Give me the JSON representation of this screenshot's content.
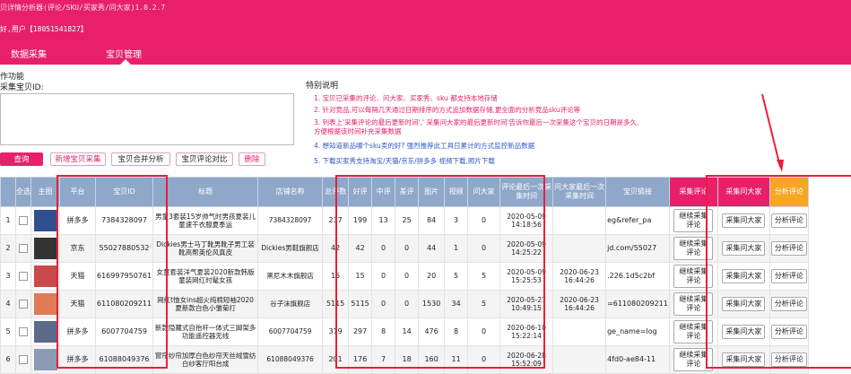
{
  "header": {
    "title": "贝详情分析器(评论/SKU/买家秀/问大家)1.0.2.7",
    "user": "好,用户【18051541827】",
    "nav": [
      "数据采集",
      "宝贝管理"
    ],
    "active_nav": "宝贝管理"
  },
  "left": {
    "section_label": "作功能",
    "input_label": "采集宝贝ID:",
    "input_value": "",
    "buttons": [
      "查询",
      "新增宝贝采集",
      "宝贝合并分析",
      "宝贝评论对比",
      "删除"
    ]
  },
  "notes": {
    "title": "特别说明",
    "lines": [
      "1. 宝贝已采集的评论、问大家、买家秀、sku 都支持本地存储",
      "2. 针对竞品,可以每隔几天通过日期排序的方式追加数据存储,更全面的分析竞品sku评论等",
      "3. 列表上'采集评论的最后更新时间',' 采集问大家的最后更新时间'告诉你最后一次采集这个宝贝的日期是多久,",
      "方便根据该时间补充采集数据",
      "4. 想知道新品哪个sku卖的好? 强烈推荐此工具日累计的方式监控新品数据",
      "5. 下载买家秀支持淘宝/天猫/京东/拼多多 视频下载,照片下载"
    ]
  },
  "table": {
    "headers": [
      "",
      "全选",
      "主图",
      "平台",
      "宝贝ID",
      "标题",
      "店铺名称",
      "总评数",
      "好评",
      "中评",
      "差评",
      "图片",
      "视频",
      "问大家",
      "评论最后一次采集时间",
      "问大家最后一次采集时间",
      "宝贝链接",
      "采集评论",
      "采集问大家",
      "分析评论"
    ],
    "rows": [
      {
        "idx": "1",
        "platform": "拼多多",
        "id": "7384328097",
        "title": "男童3套装15岁帅气时男孩夏装儿童速干衣服夏季运",
        "shop": "7384328097",
        "total": "237",
        "good": "199",
        "mid": "13",
        "bad": "25",
        "img": "84",
        "video": "3",
        "ask": "0",
        "cmt_time": "2020-05-09 14:18:56",
        "ask_time": "",
        "link": "eg&refer_pa",
        "b1": "继续采集评论",
        "b2": "采集问大家",
        "b3": "分析评论",
        "thumb": "#2f4f8f"
      },
      {
        "idx": "2",
        "platform": "京东",
        "id": "55027880532",
        "title": "Dickies男士马丁靴男靴子男工装靴高帮英伦风真皮",
        "shop": "Dickies男鞋旗舰店",
        "total": "42",
        "good": "42",
        "mid": "0",
        "bad": "0",
        "img": "44",
        "video": "1",
        "ask": "0",
        "cmt_time": "2020-05-09 14:25:22",
        "ask_time": "",
        "link": "jd.com/55027",
        "b1": "继续采集评论",
        "b2": "采集问大家",
        "b3": "分析评论",
        "thumb": "#333333"
      },
      {
        "idx": "3",
        "platform": "天猫",
        "id": "616997950761",
        "title": "女童套装洋气夏装2020新款韩版童装网红时髦女孩",
        "shop": "黑尼木木旗舰店",
        "total": "15",
        "good": "15",
        "mid": "0",
        "bad": "0",
        "img": "20",
        "video": "5",
        "ask": "5",
        "cmt_time": "2020-05-09 15:25:53",
        "ask_time": "2020-06-23 16:44:26",
        "link": ".226.1d5c2bf",
        "b1": "继续采集评论",
        "b2": "采集问大家",
        "b3": "分析评论",
        "thumb": "#c94a4a"
      },
      {
        "idx": "4",
        "platform": "天猫",
        "id": "611080209211",
        "title": "网红t恤女ins超火纯棉短袖2020夏新款白色小雏菊打",
        "shop": "谷子沫旗舰店",
        "total": "5115",
        "good": "5115",
        "mid": "0",
        "bad": "0",
        "img": "1530",
        "video": "34",
        "ask": "5",
        "cmt_time": "2020-05-27 10:49:15",
        "ask_time": "2020-06-23 16:44:26",
        "link": "=611080209211",
        "b1": "继续采集评论",
        "b2": "采集问大家",
        "b3": "分析评论",
        "thumb": "#e07b54"
      },
      {
        "idx": "5",
        "platform": "拼多多",
        "id": "6007704759",
        "title": "新款隐藏式自抬杆一体式三脚架多功能遥控器无线",
        "shop": "6007704759",
        "total": "319",
        "good": "297",
        "mid": "8",
        "bad": "14",
        "img": "476",
        "video": "8",
        "ask": "0",
        "cmt_time": "2020-06-10 15:22:14",
        "ask_time": "",
        "link": "ge_name=log",
        "b1": "继续采集评论",
        "b2": "采集问大家",
        "b3": "分析评论",
        "thumb": "#5a6b8c"
      },
      {
        "idx": "6",
        "platform": "拼多多",
        "id": "61088049376",
        "title": "窗帘纱帘加厚白色纱帘天丝绒雪纺白纱客厅阳台成",
        "shop": "61088049376",
        "total": "201",
        "good": "176",
        "mid": "7",
        "bad": "18",
        "img": "160",
        "video": "11",
        "ask": "0",
        "cmt_time": "2020-06-28 15:52:09",
        "ask_time": "",
        "link": "4fd0-ae84-11",
        "b1": "继续采集评论",
        "b2": "采集问大家",
        "b3": "分析评论",
        "thumb": "#8a9bb5"
      }
    ]
  },
  "colors": {
    "brand": "#e8206a",
    "header_bg": "#8fa7c9",
    "note_blue": "#2b57c8",
    "highlight": "#e8203a",
    "orange": "#f5a623"
  }
}
